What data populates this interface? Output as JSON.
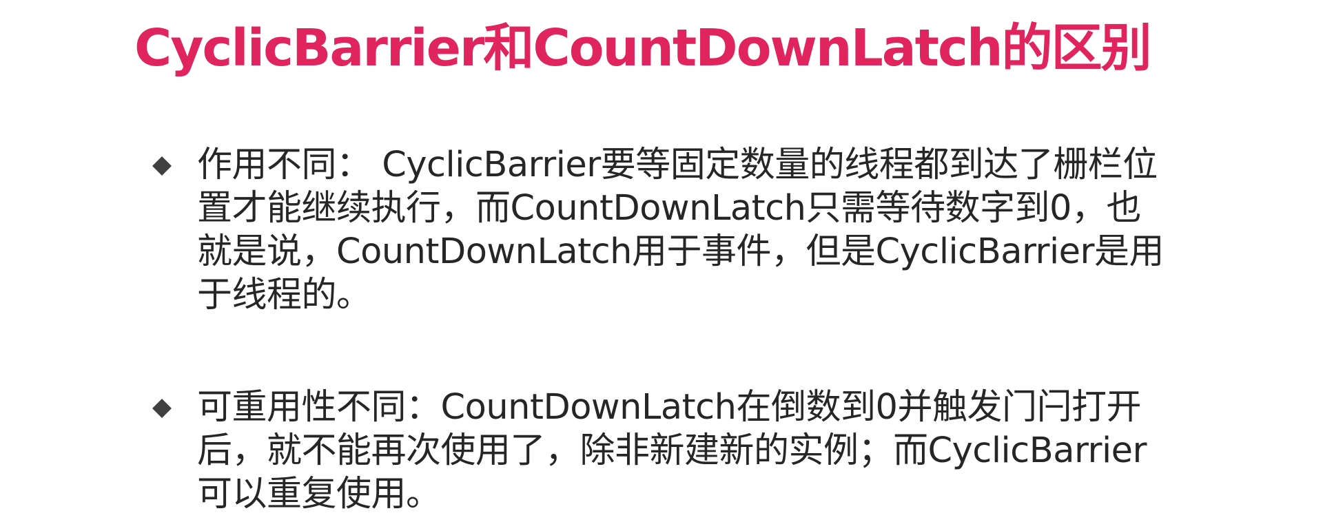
{
  "slide": {
    "title": "CyclicBarrier和CountDownLatch的区别",
    "bullets": [
      {
        "lines": [
          "作用不同： CyclicBarrier要等固定数量的线程都到达了栅栏位",
          "置才能继续执行，而CountDownLatch只需等待数字到0，也",
          "就是说，CountDownLatch用于事件，但是CyclicBarrier是用",
          "于线程的。"
        ]
      },
      {
        "lines": [
          "可重用性不同：CountDownLatch在倒数到0并触发门闩打开",
          "后，就不能再次使用了，除非新建新的实例；而CyclicBarrier",
          "可以重复使用。"
        ]
      }
    ]
  },
  "icons": {
    "bullet_icon": "diamond-bullet-icon"
  },
  "colors": {
    "title": "#e0245e",
    "body_text": "#262626",
    "bullet": "#404040",
    "background": "#ffffff"
  }
}
